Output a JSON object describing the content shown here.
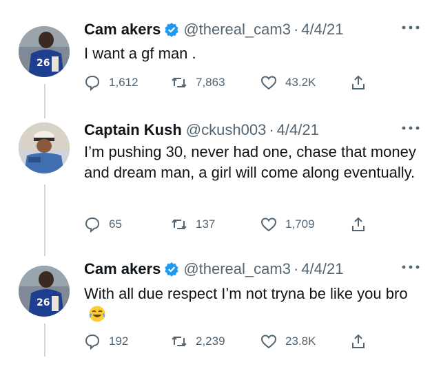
{
  "tweets": [
    {
      "name": "Cam akers",
      "verified": true,
      "handle": "@thereal_cam3",
      "separator": "·",
      "date": "4/4/21",
      "text": "I want a gf man .",
      "replies": "1,612",
      "retweets": "7,863",
      "likes": "43.2K"
    },
    {
      "name": "Captain Kush",
      "verified": false,
      "handle": "@ckush003",
      "separator": "·",
      "date": "4/4/21",
      "text": "I’m pushing 30, never had one, chase that money and dream man, a girl will come along eventually.",
      "replies": "65",
      "retweets": "137",
      "likes": "1,709"
    },
    {
      "name": "Cam akers",
      "verified": true,
      "handle": "@thereal_cam3",
      "separator": "·",
      "date": "4/4/21",
      "text": "With all due respect I’m not tryna be like you bro",
      "emoji": "face-with-tears-of-joy",
      "replies": "192",
      "retweets": "2,239",
      "likes": "23.8K"
    }
  ],
  "colors": {
    "text": "#0f1419",
    "secondary": "#536471",
    "verified": "#1d9bf0",
    "thread_line": "#cfd9de"
  }
}
